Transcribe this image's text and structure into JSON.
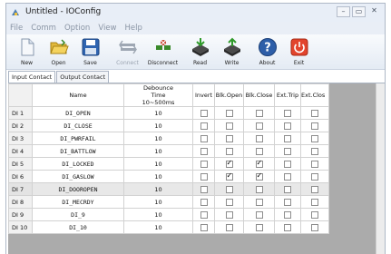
{
  "window": {
    "title": "Untitled - IOConfig",
    "controls": [
      "–",
      "▭",
      "✕"
    ]
  },
  "menu": [
    "File",
    "Comm",
    "Option",
    "View",
    "Help"
  ],
  "toolbar": [
    {
      "id": "new",
      "label": "New",
      "icon": "new-file-icon",
      "enabled": true
    },
    {
      "id": "open",
      "label": "Open",
      "icon": "open-folder-icon",
      "enabled": true
    },
    {
      "id": "save",
      "label": "Save",
      "icon": "save-disk-icon",
      "enabled": true
    },
    {
      "id": "connect",
      "label": "Connect",
      "icon": "connect-icon",
      "enabled": false
    },
    {
      "id": "disconnect",
      "label": "Disconnect",
      "icon": "disconnect-icon",
      "enabled": true
    },
    {
      "id": "read",
      "label": "Read",
      "icon": "read-icon",
      "enabled": true
    },
    {
      "id": "write",
      "label": "Write",
      "icon": "write-icon",
      "enabled": true
    },
    {
      "id": "about",
      "label": "About",
      "icon": "help-icon",
      "enabled": true
    },
    {
      "id": "exit",
      "label": "Exit",
      "icon": "power-icon",
      "enabled": true
    }
  ],
  "tabs": [
    {
      "label": "Input Contact",
      "active": true
    },
    {
      "label": "Output Contact",
      "active": false
    }
  ],
  "table": {
    "columns": [
      "Name",
      "Debounce Time 10~500ms",
      "Invert",
      "Blk.Open",
      "Blk.Close",
      "Ext.Trip",
      "Ext.Clos"
    ],
    "rows": [
      {
        "id": "DI 1",
        "name": "DI_OPEN",
        "debounce": "10",
        "invert": false,
        "blk_open": false,
        "blk_close": false,
        "ext_trip": false,
        "ext_close": false
      },
      {
        "id": "DI 2",
        "name": "DI_CLOSE",
        "debounce": "10",
        "invert": false,
        "blk_open": false,
        "blk_close": false,
        "ext_trip": false,
        "ext_close": false
      },
      {
        "id": "DI 3",
        "name": "DI_PWRFAIL",
        "debounce": "10",
        "invert": false,
        "blk_open": false,
        "blk_close": false,
        "ext_trip": false,
        "ext_close": false
      },
      {
        "id": "DI 4",
        "name": "DI_BATTLOW",
        "debounce": "10",
        "invert": false,
        "blk_open": false,
        "blk_close": false,
        "ext_trip": false,
        "ext_close": false
      },
      {
        "id": "DI 5",
        "name": "DI_LOCKED",
        "debounce": "10",
        "invert": false,
        "blk_open": true,
        "blk_close": true,
        "ext_trip": false,
        "ext_close": false
      },
      {
        "id": "DI 6",
        "name": "DI_GASLOW",
        "debounce": "10",
        "invert": false,
        "blk_open": true,
        "blk_close": true,
        "ext_trip": false,
        "ext_close": false
      },
      {
        "id": "DI 7",
        "name": "DI_DOOROPEN",
        "debounce": "10",
        "invert": false,
        "blk_open": false,
        "blk_close": false,
        "ext_trip": false,
        "ext_close": false,
        "selected": true
      },
      {
        "id": "DI 8",
        "name": "DI_MECRDY",
        "debounce": "10",
        "invert": false,
        "blk_open": false,
        "blk_close": false,
        "ext_trip": false,
        "ext_close": false
      },
      {
        "id": "DI 9",
        "name": "DI_9",
        "debounce": "10",
        "invert": false,
        "blk_open": false,
        "blk_close": false,
        "ext_trip": false,
        "ext_close": false
      },
      {
        "id": "DI 10",
        "name": "DI_10",
        "debounce": "10",
        "invert": false,
        "blk_open": false,
        "blk_close": false,
        "ext_trip": false,
        "ext_close": false
      }
    ]
  }
}
